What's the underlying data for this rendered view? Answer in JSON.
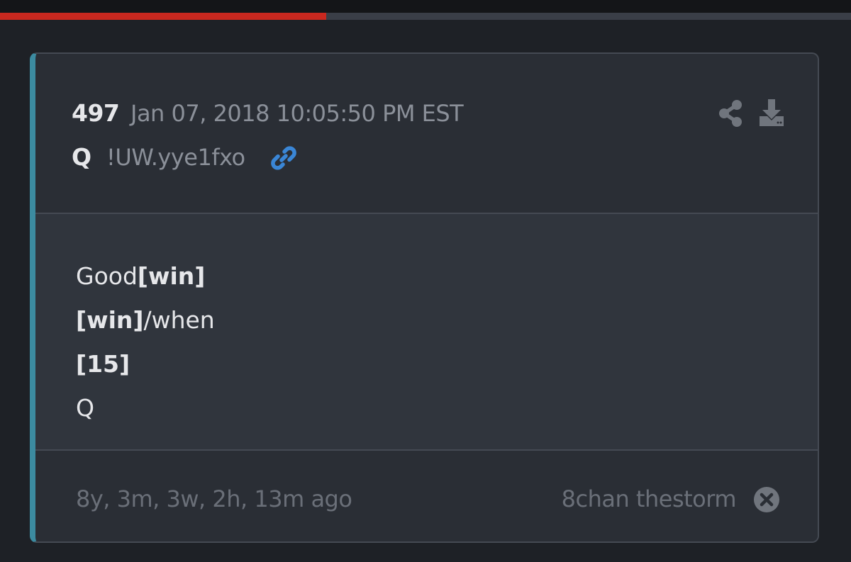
{
  "progress": {
    "value": 0.383
  },
  "post": {
    "number": "497",
    "date": "Jan 07, 2018 10:05:50 PM EST",
    "author": "Q",
    "tripcode": "!UW.yye1fxo",
    "body": {
      "line1_text": "Good",
      "line1_bold": "[win]",
      "line2_bold": "[win]",
      "line2_text": "/when",
      "line3_bold": "[15]",
      "line4_text": "Q"
    },
    "age": "8y, 3m, 3w, 2h, 13m ago",
    "source": "8chan thestorm"
  },
  "icons": {
    "link": "link-icon",
    "share": "share-icon",
    "download": "download-icon",
    "close": "close-icon"
  },
  "colors": {
    "accent_bar": "#3c8ba0",
    "progress": "#c9281f",
    "link": "#3a86d6"
  }
}
